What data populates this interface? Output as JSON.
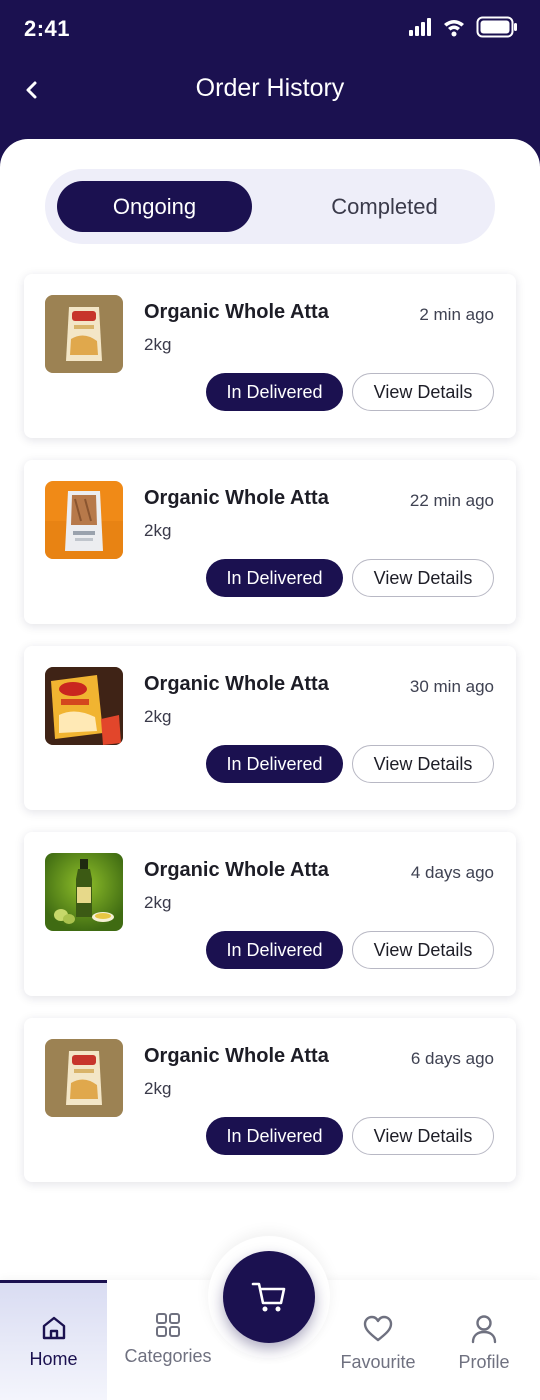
{
  "status_bar": {
    "time": "2:41"
  },
  "header": {
    "title": "Order History"
  },
  "tabs": [
    {
      "label": "Ongoing",
      "active": true
    },
    {
      "label": "Completed",
      "active": false
    }
  ],
  "orders": [
    {
      "name": "Organic Whole Atta",
      "qty": "2kg",
      "time": "2 min ago",
      "status": "In Delivered",
      "action": "View Details",
      "thumb": "atta-pack-icon"
    },
    {
      "name": "Organic Whole Atta",
      "qty": "2kg",
      "time": "22 min ago",
      "status": "In Delivered",
      "action": "View Details",
      "thumb": "flour-bag-icon"
    },
    {
      "name": "Organic Whole Atta",
      "qty": "2kg",
      "time": "30 min ago",
      "status": "In Delivered",
      "action": "View Details",
      "thumb": "snack-pack-icon"
    },
    {
      "name": "Organic Whole Atta",
      "qty": "2kg",
      "time": "4 days ago",
      "status": "In Delivered",
      "action": "View Details",
      "thumb": "olive-oil-bottle-icon"
    },
    {
      "name": "Organic Whole Atta",
      "qty": "2kg",
      "time": "6 days ago",
      "status": "In Delivered",
      "action": "View Details",
      "thumb": "atta-pack-icon"
    }
  ],
  "bottom_nav": {
    "home": "Home",
    "categories": "Categories",
    "favourite": "Favourite",
    "profile": "Profile"
  },
  "colors": {
    "primary": "#1b1150",
    "tab_track": "#eeeef9",
    "active_nav_bg": "#d9dcf2"
  }
}
